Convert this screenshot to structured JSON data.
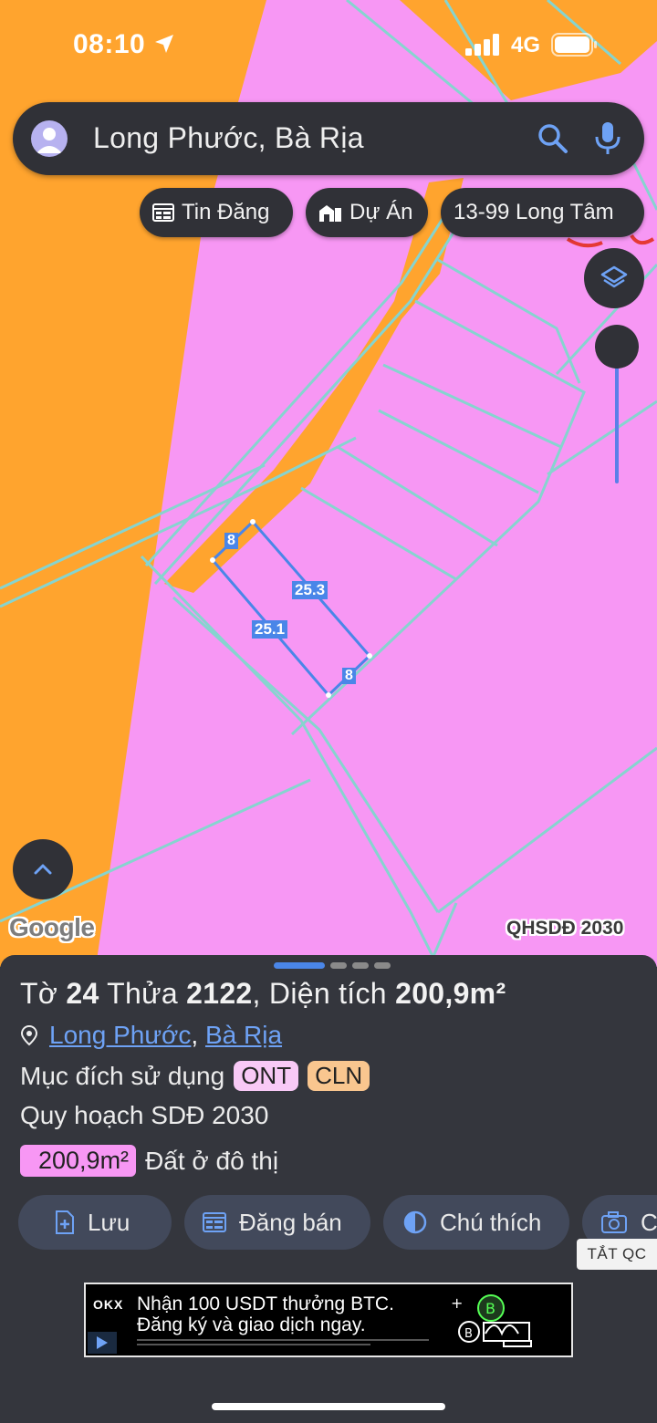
{
  "status_bar": {
    "time": "08:10",
    "network": "4G"
  },
  "search": {
    "query": "Long Phước, Bà Rịa"
  },
  "chips": [
    {
      "label": "Tin Đăng",
      "icon": "listing-icon"
    },
    {
      "label": "Dự Án",
      "icon": "project-icon"
    },
    {
      "label": "13-99 Long Tâm",
      "icon": ""
    }
  ],
  "map": {
    "parcel_edges": [
      "8",
      "25.3",
      "25.1",
      "8"
    ],
    "attribution": "Google",
    "layer_label": "QHSDĐ 2030",
    "colors": {
      "residential": "#f797f4",
      "road": "#ffa42e",
      "boundary": "#86d4cf",
      "selection": "#4a90e2"
    }
  },
  "parcel": {
    "title_prefix": "Tờ",
    "sheet_no": "24",
    "lot_label": "Thửa",
    "lot_no": "2122",
    "area_label": ", Diện tích",
    "area": "200,9m²",
    "commune": "Long Phước",
    "city": "Bà Rịa",
    "purpose_label": "Mục đích sử dụng",
    "purpose_tags": [
      {
        "code": "ONT",
        "color": "#f8c9f6"
      },
      {
        "code": "CLN",
        "color": "#f9c68f"
      }
    ],
    "plan_label": "Quy hoạch SDĐ 2030",
    "plan_area": "200,9m²",
    "plan_use": "Đất ở đô thị"
  },
  "actions": [
    {
      "label": "Lưu",
      "icon": "save-document-icon"
    },
    {
      "label": "Đăng bán",
      "icon": "post-sale-icon"
    },
    {
      "label": "Chú thích",
      "icon": "legend-icon"
    },
    {
      "label": "C",
      "icon": "camera-icon"
    }
  ],
  "ad": {
    "off_label": "TẮT QC",
    "brand": "OKX",
    "line1": "Nhận 100 USDT thưởng BTC.",
    "line2": "Đăng ký và giao dịch ngay."
  }
}
